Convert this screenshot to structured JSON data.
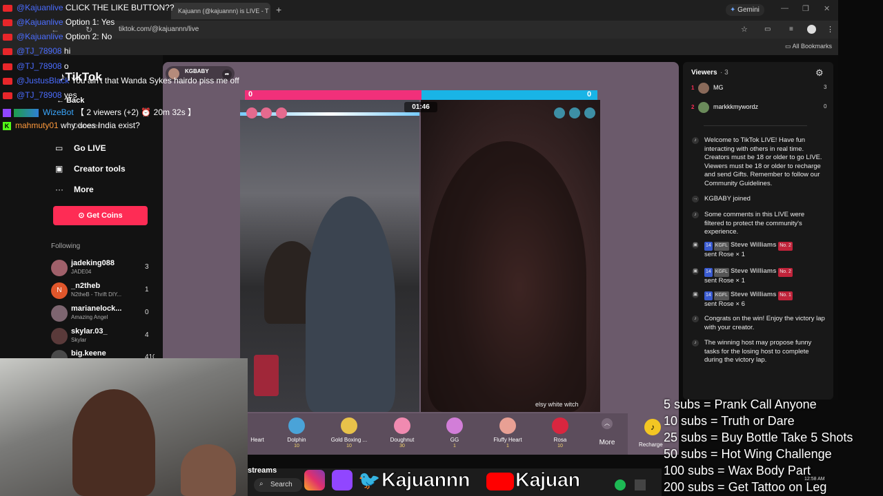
{
  "browser": {
    "tab_title": "Kajuann (@kajuannn) is LIVE - T",
    "gemini_label": "Gemini",
    "url": "tiktok.com/@kajuannn/live",
    "all_bookmarks": "All Bookmarks"
  },
  "sidebar": {
    "logo": "TikTok",
    "back": "Back",
    "discover": "Discover",
    "items": [
      "Go LIVE",
      "Creator tools",
      "More"
    ],
    "get_coins": "Get Coins",
    "following_label": "Following",
    "following": [
      {
        "name": "jadeking088",
        "sub": "JADE04",
        "count": "3"
      },
      {
        "name": "_n2theb",
        "sub": "N2theB - Thrift DIY...",
        "count": "1"
      },
      {
        "name": "marianelock...",
        "sub": "Amazing Angel",
        "count": "0"
      },
      {
        "name": "skylar.03_",
        "sub": "Skylar",
        "count": "4"
      },
      {
        "name": "big.keene",
        "sub": "",
        "count": "410"
      }
    ]
  },
  "stream": {
    "host_name": "KGBABY",
    "score_left": "0",
    "score_right": "0",
    "timer": "01:46",
    "opponent_name": "elsy white witch",
    "score_share_left": 0.5
  },
  "gifts": [
    {
      "name": "Heart",
      "cost": ""
    },
    {
      "name": "Dolphin",
      "cost": "10"
    },
    {
      "name": "Gold Boxing ...",
      "cost": "10"
    },
    {
      "name": "Doughnut",
      "cost": "30"
    },
    {
      "name": "GG",
      "cost": "1"
    },
    {
      "name": "Fluffy Heart",
      "cost": "1"
    },
    {
      "name": "Rosa",
      "cost": "10"
    }
  ],
  "gift_more": "More",
  "recharge": "Recharge",
  "viewers": {
    "title": "Viewers",
    "count": "· 3",
    "list": [
      {
        "rank": "1",
        "name": "MG",
        "count": "3"
      },
      {
        "rank": "2",
        "name": "markkkmywordz",
        "count": "0"
      }
    ]
  },
  "comments": [
    {
      "text": "Welcome to TikTok LIVE! Have fun interacting with others in real time. Creators must be 18 or older to go LIVE. Viewers must be 18 or older to recharge and send Gifts. Remember to follow our Community Guidelines."
    },
    {
      "text": "KGBABY  joined"
    },
    {
      "text": "Some comments in this LIVE were filtered to protect the community's experience."
    },
    {
      "user": "Steve Williams",
      "level": "14",
      "team": "KGFL",
      "rank": "No. 2",
      "text": "sent Rose × 1"
    },
    {
      "user": "Steve Williams",
      "level": "14",
      "team": "KGFL",
      "rank": "No. 2",
      "text": "sent Rose × 1"
    },
    {
      "user": "Steve Williams",
      "level": "14",
      "team": "KGFL",
      "rank": "No. 1",
      "text": "sent Rose × 6"
    },
    {
      "text": "Congrats on the win! Enjoy the victory lap with your creator."
    },
    {
      "text": "The winning host may propose funny tasks for the losing host to complete during the victory lap."
    }
  ],
  "chat_overlay": [
    {
      "user": "@Kajuanlive",
      "msg": "CLICK THE LIKE BUTTON??"
    },
    {
      "user": "@Kajuanlive",
      "msg": "Option 1: Yes"
    },
    {
      "user": "@Kajuanlive",
      "msg": "Option 2: No"
    },
    {
      "user": "@TJ_78908",
      "msg": "hi"
    },
    {
      "user": "@TJ_78908",
      "msg": "o"
    },
    {
      "user": "@JustusBlack",
      "msg": "You ain't that Wanda Sykes hairdo piss me off"
    },
    {
      "user": "@TJ_78908",
      "msg": "yes"
    },
    {
      "user": "WizeBot",
      "msg": "【 2 viewers (+2) ⏰ 20m 32s 】"
    },
    {
      "user": "mahmuty01",
      "msg": "why does India exist?"
    }
  ],
  "bottom": {
    "streams_label": "streams",
    "search_label": "Search",
    "brand_left": "Kajuannn",
    "brand_right": "Kajuan",
    "clock": "12:58 AM"
  },
  "sub_goals": [
    "5 subs =  Prank Call Anyone",
    "10 subs = Truth or Dare",
    "25 subs = Buy Bottle Take 5 Shots",
    "50 subs = Hot Wing Challenge",
    "100 subs = Wax Body Part",
    "200 subs = Get Tattoo on Leg"
  ],
  "colors": {
    "tiktok_red": "#fe2c55",
    "battle_pink": "#f1307a",
    "battle_cyan": "#19b4e6",
    "chat_user_blue": "#4a6cff"
  }
}
